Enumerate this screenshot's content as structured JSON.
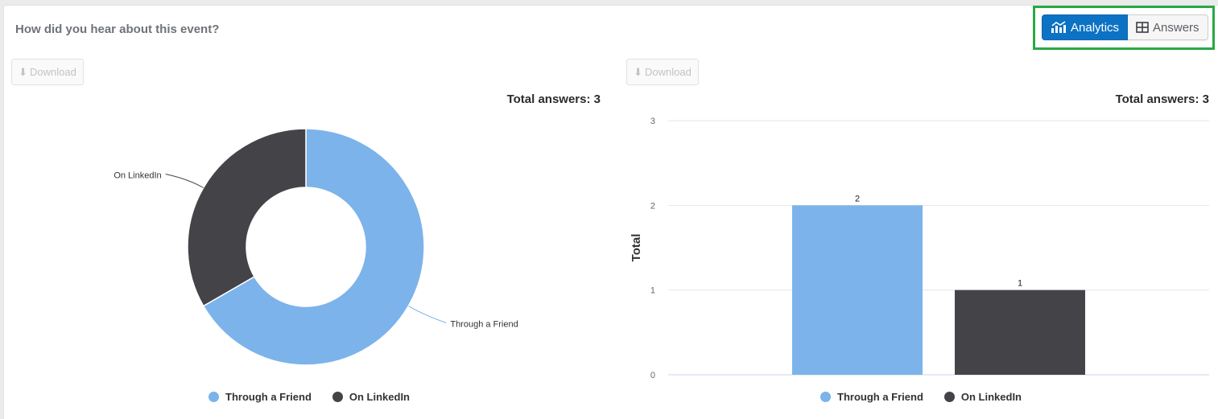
{
  "question": {
    "title": "How did you hear about this event?"
  },
  "view_toggle": {
    "analytics_label": "Analytics",
    "answers_label": "Answers",
    "active": "Analytics"
  },
  "download": {
    "label": "Download",
    "icon": "download-arrow-icon"
  },
  "colors": {
    "series_1": "#7cb3ea",
    "series_2": "#434348",
    "toggle_active": "#0c72c4",
    "highlight_frame": "#2aa845"
  },
  "chart_data": [
    {
      "type": "pie",
      "variant": "donut",
      "total_label": "Total answers: 3",
      "categories": [
        "Through a Friend",
        "On LinkedIn"
      ],
      "values": [
        2,
        1
      ],
      "data_labels": [
        "Through a Friend",
        "On LinkedIn"
      ],
      "legend": {
        "position": "bottom",
        "entries": [
          "Through a Friend",
          "On LinkedIn"
        ]
      }
    },
    {
      "type": "bar",
      "total_label": "Total answers: 3",
      "categories": [
        "Through a Friend",
        "On LinkedIn"
      ],
      "values": [
        2,
        1
      ],
      "data_labels": [
        "2",
        "1"
      ],
      "xlabel": "",
      "ylabel": "Total",
      "ylim": [
        0,
        3
      ],
      "yticks": [
        "0",
        "1",
        "2",
        "3"
      ],
      "grid": true,
      "legend": {
        "position": "bottom",
        "entries": [
          "Through a Friend",
          "On LinkedIn"
        ]
      }
    }
  ]
}
